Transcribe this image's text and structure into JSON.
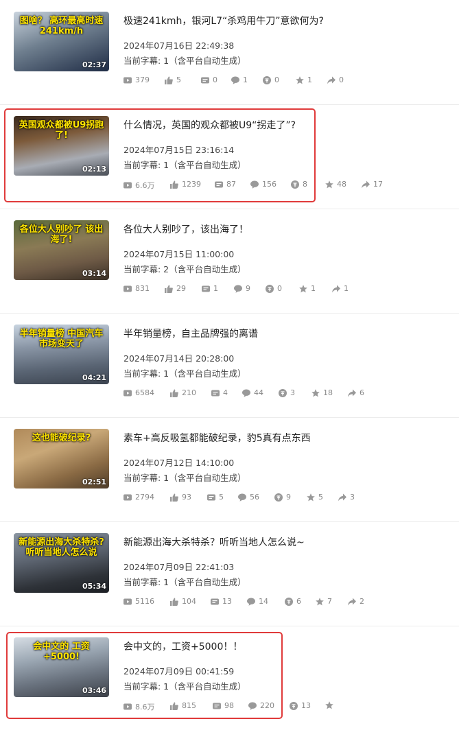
{
  "colors": {
    "highlight": "#e03a3a",
    "icon": "#999999"
  },
  "items": [
    {
      "title": "极速241kmh，银河L7“杀鸡用牛刀”意欲何为?",
      "date": "2024年07月16日 22:49:38",
      "subtitle": "当前字幕: 1（含平台自动生成）",
      "duration": "02:37",
      "overlay": "图啥？ 高环最高时速241km/h",
      "stats": {
        "play": "379",
        "like": "5",
        "danmaku": "0",
        "comment": "1",
        "coin": "0",
        "favorite": "1",
        "share": "0"
      }
    },
    {
      "title": "什么情况，英国的观众都被U9“拐走了”?",
      "date": "2024年07月15日 23:16:14",
      "subtitle": "当前字幕: 1（含平台自动生成）",
      "duration": "02:13",
      "overlay": "英国观众都被U9拐跑了!",
      "stats": {
        "play": "6.6万",
        "like": "1239",
        "danmaku": "87",
        "comment": "156",
        "coin": "8",
        "favorite": "48",
        "share": "17"
      }
    },
    {
      "title": "各位大人别吵了，该出海了！",
      "date": "2024年07月15日 11:00:00",
      "subtitle": "当前字幕: 2（含平台自动生成）",
      "duration": "03:14",
      "overlay": "各位大人别吵了 该出海了!",
      "stats": {
        "play": "831",
        "like": "29",
        "danmaku": "1",
        "comment": "9",
        "coin": "0",
        "favorite": "1",
        "share": "1"
      }
    },
    {
      "title": "半年销量榜，自主品牌强的离谱",
      "date": "2024年07月14日 20:28:00",
      "subtitle": "当前字幕: 1（含平台自动生成）",
      "duration": "04:21",
      "overlay": "半年销量榜 中国汽车市场变天了",
      "stats": {
        "play": "6584",
        "like": "210",
        "danmaku": "4",
        "comment": "44",
        "coin": "3",
        "favorite": "18",
        "share": "6"
      }
    },
    {
      "title": "素车+高反吸氢都能破纪录，豹5真有点东西",
      "date": "2024年07月12日 14:10:00",
      "subtitle": "当前字幕: 1（含平台自动生成）",
      "duration": "02:51",
      "overlay": "这也能破纪录?",
      "stats": {
        "play": "2794",
        "like": "93",
        "danmaku": "5",
        "comment": "56",
        "coin": "9",
        "favorite": "5",
        "share": "3"
      }
    },
    {
      "title": "新能源出海大杀特杀？听听当地人怎么说~",
      "date": "2024年07月09日 22:41:03",
      "subtitle": "当前字幕: 1（含平台自动生成）",
      "duration": "05:34",
      "overlay": "新能源出海大杀特杀? 听听当地人怎么说",
      "stats": {
        "play": "5116",
        "like": "104",
        "danmaku": "13",
        "comment": "14",
        "coin": "6",
        "favorite": "7",
        "share": "2"
      }
    },
    {
      "title": "会中文的，工资+5000！！",
      "date": "2024年07月09日 00:41:59",
      "subtitle": "当前字幕: 1（含平台自动生成）",
      "duration": "03:46",
      "overlay": "会中文的 工资+5000!",
      "stats": {
        "play": "8.6万",
        "like": "815",
        "danmaku": "98",
        "comment": "220",
        "coin": "13",
        "favorite": "",
        "share": ""
      }
    }
  ]
}
